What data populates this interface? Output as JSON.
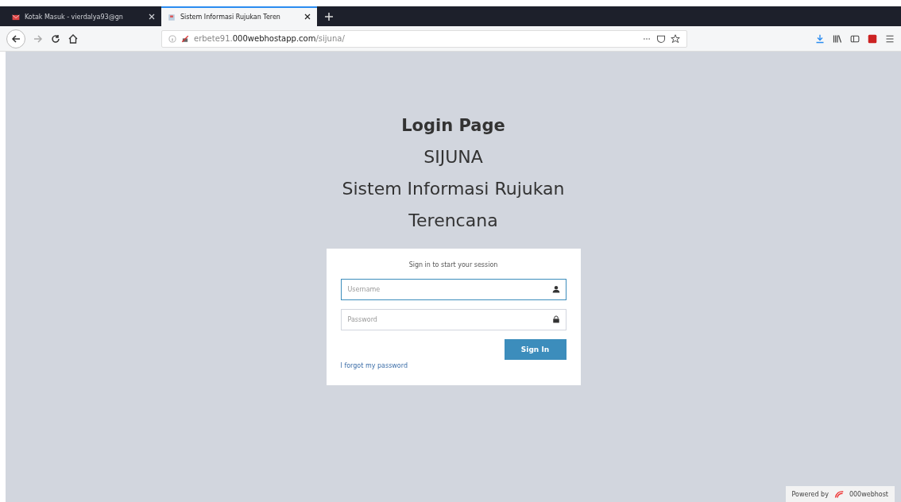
{
  "browser": {
    "tabs": [
      {
        "title": "Kotak Masuk - vierdalya93@gn",
        "selected": false
      },
      {
        "title": "Sistem Informasi Rujukan Teren",
        "selected": true
      }
    ],
    "url": {
      "subdomain": "erbete91.",
      "domain": "000webhostapp.com",
      "path": "/sijuna/"
    }
  },
  "login": {
    "headings": [
      "Login Page",
      "SIJUNA",
      "Sistem Informasi Rujukan",
      "Terencana"
    ],
    "box_message": "Sign in to start your session",
    "fields": [
      {
        "kind": "text",
        "placeholder": "Username",
        "focused": true
      },
      {
        "kind": "password",
        "placeholder": "Password",
        "focused": false
      }
    ],
    "button": "Sign In",
    "forgot_link": "I forgot my password"
  },
  "footer_badge": {
    "prefix": "Powered by",
    "brand": "000webhost"
  }
}
